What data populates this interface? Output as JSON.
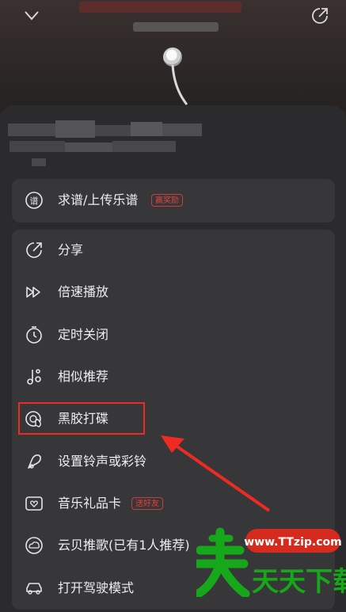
{
  "header": {
    "collapse_icon": "chevron-down-icon",
    "share_icon": "share-arrow-icon"
  },
  "menu": {
    "top_item": {
      "label": "求谱/上传乐谱",
      "badge": "赢奖励",
      "icon": "score-icon"
    },
    "items": [
      {
        "label": "分享",
        "icon": "share-icon"
      },
      {
        "label": "倍速播放",
        "icon": "speed-icon"
      },
      {
        "label": "定时关闭",
        "icon": "timer-icon"
      },
      {
        "label": "相似推荐",
        "icon": "similar-icon"
      },
      {
        "label": "黑胶打碟",
        "icon": "vinyl-icon"
      },
      {
        "label": "设置铃声或彩铃",
        "icon": "ringtone-icon"
      },
      {
        "label": "音乐礼品卡",
        "icon": "gift-card-icon",
        "badge": "送好友"
      },
      {
        "label": "云贝推歌(已有1人推荐)",
        "icon": "cloud-coin-icon"
      },
      {
        "label": "打开驾驶模式",
        "icon": "car-icon"
      }
    ]
  },
  "watermark": {
    "text": "天天下载",
    "url": "www.TTzip.com"
  },
  "colors": {
    "accent": "#e0403a",
    "highlight": "#ee2b22",
    "watermark_green": "#16a81a"
  }
}
